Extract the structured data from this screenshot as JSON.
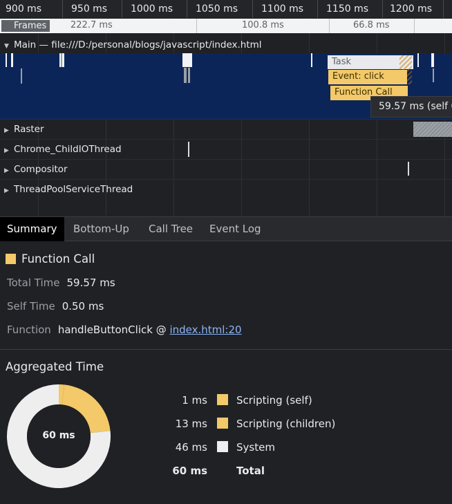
{
  "ruler": {
    "ticks": [
      "900 ms",
      "950 ms",
      "1000 ms",
      "1050 ms",
      "1100 ms",
      "1150 ms",
      "1200 ms"
    ]
  },
  "frames": {
    "label": "Frames",
    "values": [
      "222.7 ms",
      "100.8 ms",
      "66.8 ms"
    ]
  },
  "main": {
    "header": "Main — file:///D:/personal/blogs/javascript/index.html"
  },
  "flame": {
    "task": "Task",
    "event": "Event: click",
    "function": "Function Call"
  },
  "tooltip": "59.57 ms (self 0",
  "threads": [
    "Raster",
    "Chrome_ChildIOThread",
    "Compositor",
    "ThreadPoolServiceThread"
  ],
  "tabs": [
    "Summary",
    "Bottom-Up",
    "Call Tree",
    "Event Log"
  ],
  "summary": {
    "title": "Function Call",
    "total_time_label": "Total Time",
    "total_time": "59.57 ms",
    "self_time_label": "Self Time",
    "self_time": "0.50 ms",
    "function_label": "Function",
    "function_name": "handleButtonClick @",
    "function_link": "index.html:20"
  },
  "aggregated": {
    "title": "Aggregated Time",
    "center": "60 ms",
    "rows": [
      {
        "amount": "1 ms",
        "name": "Scripting (self)",
        "color": "#f3c969"
      },
      {
        "amount": "13 ms",
        "name": "Scripting (children)",
        "color": "#f3c969"
      },
      {
        "amount": "46 ms",
        "name": "System",
        "color": "#eeeeee"
      }
    ],
    "total_amount": "60 ms",
    "total_label": "Total"
  },
  "chart_data": {
    "type": "pie",
    "categories": [
      "Scripting (self)",
      "Scripting (children)",
      "System"
    ],
    "values": [
      1,
      13,
      46
    ],
    "colors": [
      "#f3c969",
      "#f3c969",
      "#eeeeee"
    ],
    "title": "Aggregated Time"
  }
}
